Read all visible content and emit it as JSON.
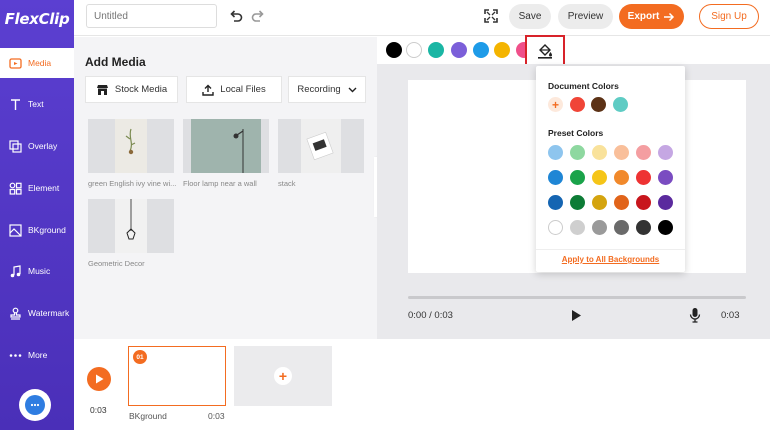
{
  "app": {
    "logo": "FlexClip"
  },
  "sidebar": {
    "items": [
      {
        "label": "Media",
        "icon": "media-icon",
        "active": true
      },
      {
        "label": "Text",
        "icon": "text-icon"
      },
      {
        "label": "Overlay",
        "icon": "overlay-icon"
      },
      {
        "label": "Element",
        "icon": "element-icon"
      },
      {
        "label": "BKground",
        "icon": "background-icon"
      },
      {
        "label": "Music",
        "icon": "music-icon"
      },
      {
        "label": "Watermark",
        "icon": "watermark-icon"
      },
      {
        "label": "More",
        "icon": "more-icon"
      }
    ]
  },
  "topbar": {
    "title_placeholder": "Untitled",
    "save_label": "Save",
    "preview_label": "Preview",
    "export_label": "Export",
    "signup_label": "Sign Up"
  },
  "media": {
    "title": "Add Media",
    "tabs": [
      {
        "label": "Stock Media"
      },
      {
        "label": "Local Files"
      },
      {
        "label": "Recording"
      }
    ],
    "items": [
      {
        "label": "green English ivy vine wi..."
      },
      {
        "label": "Floor lamp near a wall"
      },
      {
        "label": "stack"
      },
      {
        "label": "Geometric Decor"
      }
    ]
  },
  "swatches": [
    "#000000",
    "#ffffff",
    "#1ab6a4",
    "#7b5fd9",
    "#1e9be8",
    "#f4b400",
    "#f0508a"
  ],
  "color_popup": {
    "document_heading": "Document Colors",
    "document_colors": [
      "#f04537",
      "#5c3216",
      "#5fccc4"
    ],
    "preset_heading": "Preset Colors",
    "preset_colors": [
      [
        "#8ec5ee",
        "#8ed8a0",
        "#f9e29b",
        "#f9bf9a",
        "#f49ea1",
        "#c5a7e3"
      ],
      [
        "#1f86d5",
        "#1aa34a",
        "#f5c518",
        "#f1892b",
        "#ee3333",
        "#7a4cc1"
      ],
      [
        "#1565b2",
        "#0d7c36",
        "#d4a40f",
        "#e1641a",
        "#c8161d",
        "#5b2a9e"
      ],
      [
        "#ffffff",
        "#cfcfcf",
        "#9a9a9a",
        "#6a6a6a",
        "#333333",
        "#000000"
      ]
    ],
    "apply_label": "Apply to All Backgrounds"
  },
  "player": {
    "time_current": "0:00 / 0:03",
    "time_total": "0:03"
  },
  "timeline": {
    "duration": "0:03",
    "scene_number": "01",
    "scene_name": "BKground",
    "scene_duration": "0:03"
  }
}
